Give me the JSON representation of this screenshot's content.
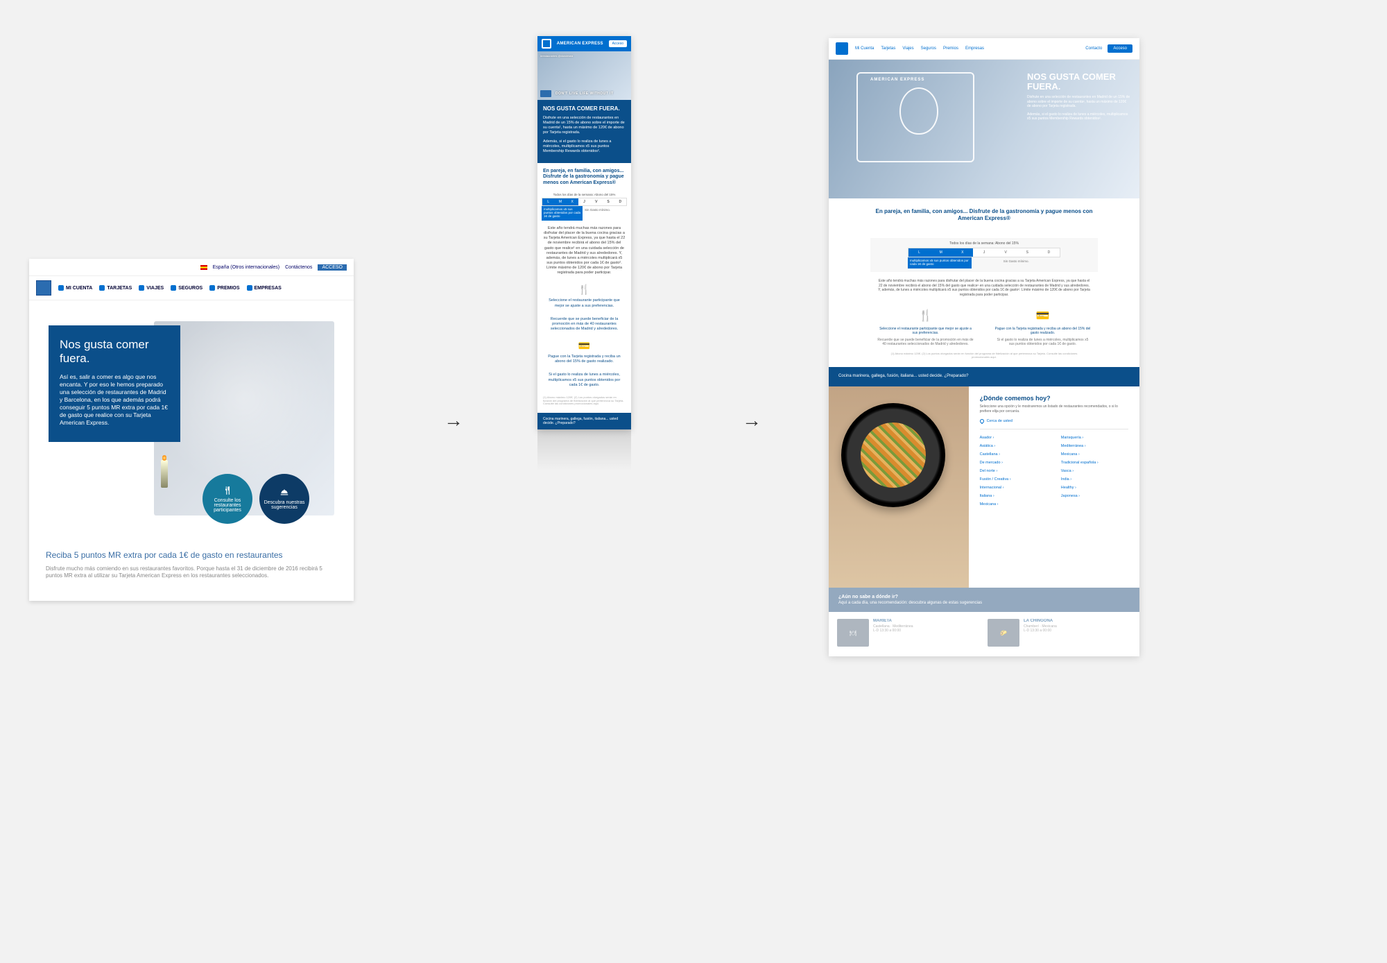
{
  "mockup1": {
    "topbar": {
      "locale": "España (Otros internacionales)",
      "contact": "Contáctenos",
      "access": "ACCESO"
    },
    "nav": [
      "MI CUENTA",
      "TARJETAS",
      "VIAJES",
      "SEGUROS",
      "PREMIOS",
      "EMPRESAS"
    ],
    "hero": {
      "title": "Nos gusta comer fuera.",
      "body": "Así es, salir a comer es algo que nos encanta. Y por eso le hemos preparado una selección de restaurantes de Madrid y Barcelona, en los que además podrá conseguir 5 puntos MR extra por cada 1€ de gasto que realice con su Tarjeta American Express.",
      "circle1": "Consulte los restaurantes participantes",
      "circle2": "Descubra nuestras sugerencias"
    },
    "subhead": "Reciba 5 puntos MR extra por cada 1€ de gasto en restaurantes",
    "subcopy": "Disfrute mucho más comiendo en sus restaurantes favoritos. Porque hasta el 31 de diciembre de 2016 recibirá 5 puntos MR extra al utilizar su Tarjeta American Express en los restaurantes seleccionados."
  },
  "mockup2": {
    "brand": "AMERICAN EXPRESS",
    "access": "Acceso",
    "hero_tag": "#restaurantes  @dondesea",
    "hero_dont": "DON'T LIVE LIFE WITHOUT IT",
    "headline": "NOS GUSTA COMER FUERA.",
    "p1": "Disfrute en una selección de restaurantes en Madrid de un 15% de abono sobre el importe de su cuenta¹, hasta un máximo de 120€ de abono por Tarjeta registrada.",
    "p2": "Además, si el gasto lo realiza de lunes a miércoles, multiplicamos x5 sus puntos Membership Rewards obtenidos².",
    "subhead": "En pareja, en familia, con amigos... Disfrute de la gastronomía y pague menos con American Express®",
    "week_label": "Todos los días de la semana: Abono del 15%",
    "days": [
      "L",
      "M",
      "X",
      "J",
      "V",
      "S",
      "D"
    ],
    "week_badge": "multiplicamos x5 sus puntos obtenidos por cada 1€ de gasto",
    "week_note": "Sin Gasto mínimo.",
    "para": "Este año tendrá muchas más razones para disfrutar del placer de la buena cocina gracias a su Tarjeta American Express, ya que hasta el 22 de noviembre recibirá el abono del 15% del gasto que realice¹ en una cuidada selección de restaurantes de Madrid y sus alrededores. Y, además, de lunes a miércoles multiplicará x5 sus puntos obtenidos por cada 1€ de gasto². Límite máximo de 120€ de abono por Tarjeta registrada para poder participar.",
    "step1": "Seleccione el restaurante participante que mejor se ajuste a sus preferencias.",
    "step1b": "Recuerde que se puede beneficiar de la promoción en más de 40 restaurantes seleccionados de Madrid y alrededores.",
    "step2": "Pague con la Tarjeta registrada y reciba un abono del 15% de gasto realizado.",
    "step2b": "Si el gasto lo realiza de lunes a miércoles, multiplicamos x5 sus puntos obtenidos por cada 1€ de gasto.",
    "fineprint": "(1) Abono máximo 120€. (2) Los puntos otorgados serán en función del programa de fidelización al que pertenezca su Tarjeta. Consulte las condiciones promocionales aquí.",
    "lowbanner": "Cocina marinera, gallega, fusión, italiana... usted decide. ¿Preparado?"
  },
  "mockup3": {
    "nav": {
      "items": [
        "Mi Cuenta",
        "Tarjetas",
        "Viajes",
        "Seguros",
        "Premios",
        "Empresas"
      ],
      "contact": "Contacto",
      "access": "Acceso"
    },
    "hero": {
      "sketch_label": "AMERICAN EXPRESS",
      "title": "NOS GUSTA COMER FUERA.",
      "p1": "Disfrute en una selección de restaurantes en Madrid de un 15% de abono sobre el importe de su cuenta¹, hasta un máximo de 120€ de abono por Tarjeta registrada.",
      "p2": "Además, si el gasto lo realiza de lunes a miércoles, multiplicamos x5 sus puntos Membership Rewards obtenidos²."
    },
    "subhead": "En pareja, en familia, con amigos... Disfrute de la gastronomía y pague menos con American Express®",
    "week_label": "Todos los días de la semana: Abono del 15%",
    "days": [
      "L",
      "M",
      "X",
      "J",
      "V",
      "S",
      "D"
    ],
    "week_badge": "multiplicamos x5 sus puntos obtenidos por cada 1€ de gasto",
    "week_note": "Sin Gasto mínimo.",
    "para": "Este año tendrá muchas más razones para disfrutar del placer de la buena cocina gracias a su Tarjeta American Express, ya que hasta el 22 de noviembre recibirá el abono del 15% del gasto que realice¹ en una cuidada selección de restaurantes de Madrid y sus alrededores. Y, además, de lunes a miércoles multiplicará x5 sus puntos obtenidos por cada 1€ de gasto². Límite máximo de 120€ de abono por Tarjeta registrada para poder participar.",
    "step1": "Seleccione el restaurante participante que mejor se ajuste a sus preferencias.",
    "step1b": "Recuerde que se puede beneficiar de la promoción en más de 40 restaurantes seleccionados de Madrid y alrededores.",
    "step2": "Pague con la Tarjeta registrada y reciba un abono del 15% del gasto realizado.",
    "step2b": "Si el gasto lo realiza de lunes a miércoles, multiplicamos x5 sus puntos obtenidos por cada 1€ de gasto.",
    "fineprint": "(1) Abono máximo 120€. (2) Los puntos otorgados serán en función del programa de fidelización al que pertenezca su Tarjeta. Consulte las condiciones promocionales aquí.",
    "banner": "Cocina marinera, gallega, fusión, italiana... usted decide. ¿Preparado?",
    "where_title": "¿Dónde comemos hoy?",
    "where_desc": "Seleccione una opción y le mostraremos un listado de restaurantes recomendados, o si lo prefiere elija por cercanía.",
    "near_you": "Cerca de usted",
    "cats_col1": [
      "Asador ›",
      "Asiática ›",
      "Castellana ›",
      "De mercado ›",
      "Del norte ›",
      "Fusión / Creativa ›",
      "Internacional ›",
      "Italiana ›",
      "Mexicana ›"
    ],
    "cats_col2": [
      "Marisquería ›",
      "Mediterránea ›",
      "Mexicana ›",
      "Tradicional española ›",
      "Vasca ›",
      "India ›",
      "Healthy ›",
      "Japonesa ›"
    ],
    "lowbanner_title": "¿Aún no sabe a dónde ir?",
    "lowbanner_sub": "Aquí a cada día, una recomendación: descubra algunas de estas sugerencias",
    "card1": {
      "name": "MARIETA",
      "loc": "Castellana · Mediterránea",
      "hours": "L-D 13:30 a 00:00"
    },
    "card2": {
      "name": "LA CHINGONA",
      "loc": "Chamberí · Mexicana",
      "hours": "L-D 13:30 a 00:00"
    }
  }
}
